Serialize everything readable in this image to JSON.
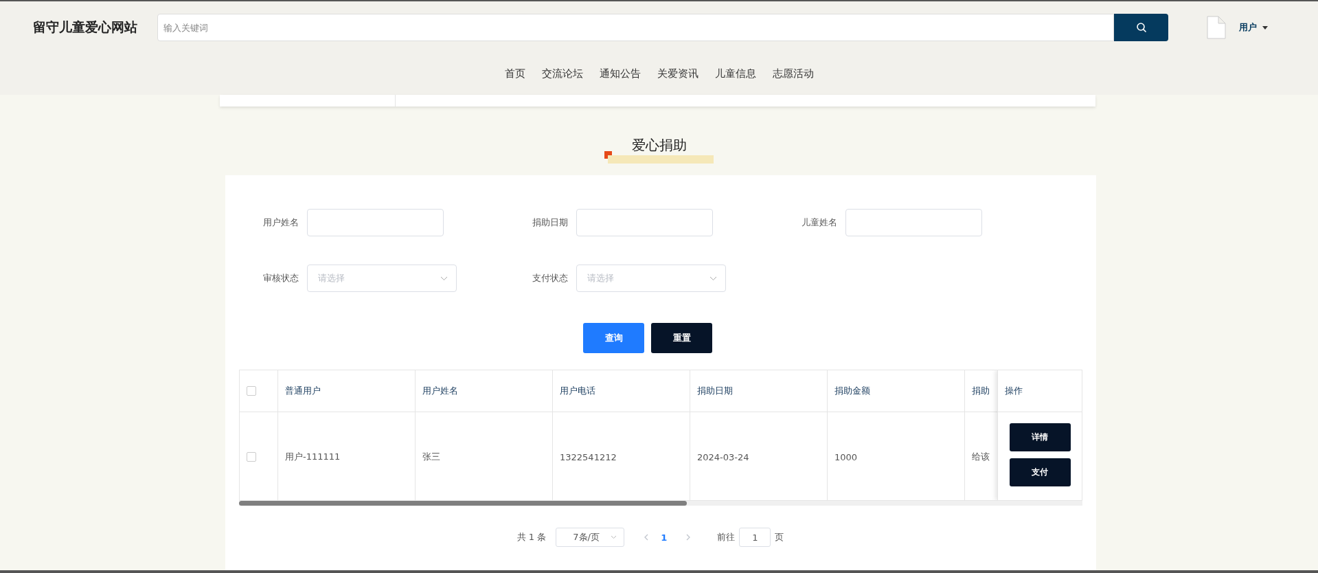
{
  "header": {
    "logo": "留守儿童爱心网站",
    "search": {
      "placeholder": "输入关键词"
    },
    "user": {
      "label": "用户"
    }
  },
  "nav": [
    {
      "label": "首页"
    },
    {
      "label": "交流论坛"
    },
    {
      "label": "通知公告"
    },
    {
      "label": "关爱资讯"
    },
    {
      "label": "儿童信息"
    },
    {
      "label": "志愿活动"
    }
  ],
  "section_title": "爱心捐助",
  "filters": [
    {
      "kind": "input",
      "label": "用户姓名"
    },
    {
      "kind": "input",
      "label": "捐助日期"
    },
    {
      "kind": "input",
      "label": "儿童姓名"
    },
    {
      "kind": "select",
      "label": "审核状态",
      "placeholder": "请选择"
    },
    {
      "kind": "select",
      "label": "支付状态",
      "placeholder": "请选择"
    }
  ],
  "buttons": [
    {
      "kind": "primary",
      "label": "查询"
    },
    {
      "kind": "dark",
      "label": "重置"
    }
  ],
  "table": {
    "select_all": {
      "checked": false
    },
    "columns": [
      "普通用户",
      "用户姓名",
      "用户电话",
      "捐助日期",
      "捐助金额",
      "捐助"
    ],
    "action_column": "操作",
    "rows": [
      {
        "checked": false,
        "cells": [
          "用户-111111",
          "张三",
          "1322541212",
          "2024-03-24",
          "1000",
          "给该"
        ],
        "actions": [
          "详情",
          "支付"
        ]
      }
    ]
  },
  "pagination": {
    "total": "共 1 条",
    "page_size": "7条/页",
    "pages": [
      {
        "label": "1",
        "selected": true
      }
    ],
    "goto_label": "前往",
    "goto_value": "1",
    "page_suffix": "页"
  }
}
